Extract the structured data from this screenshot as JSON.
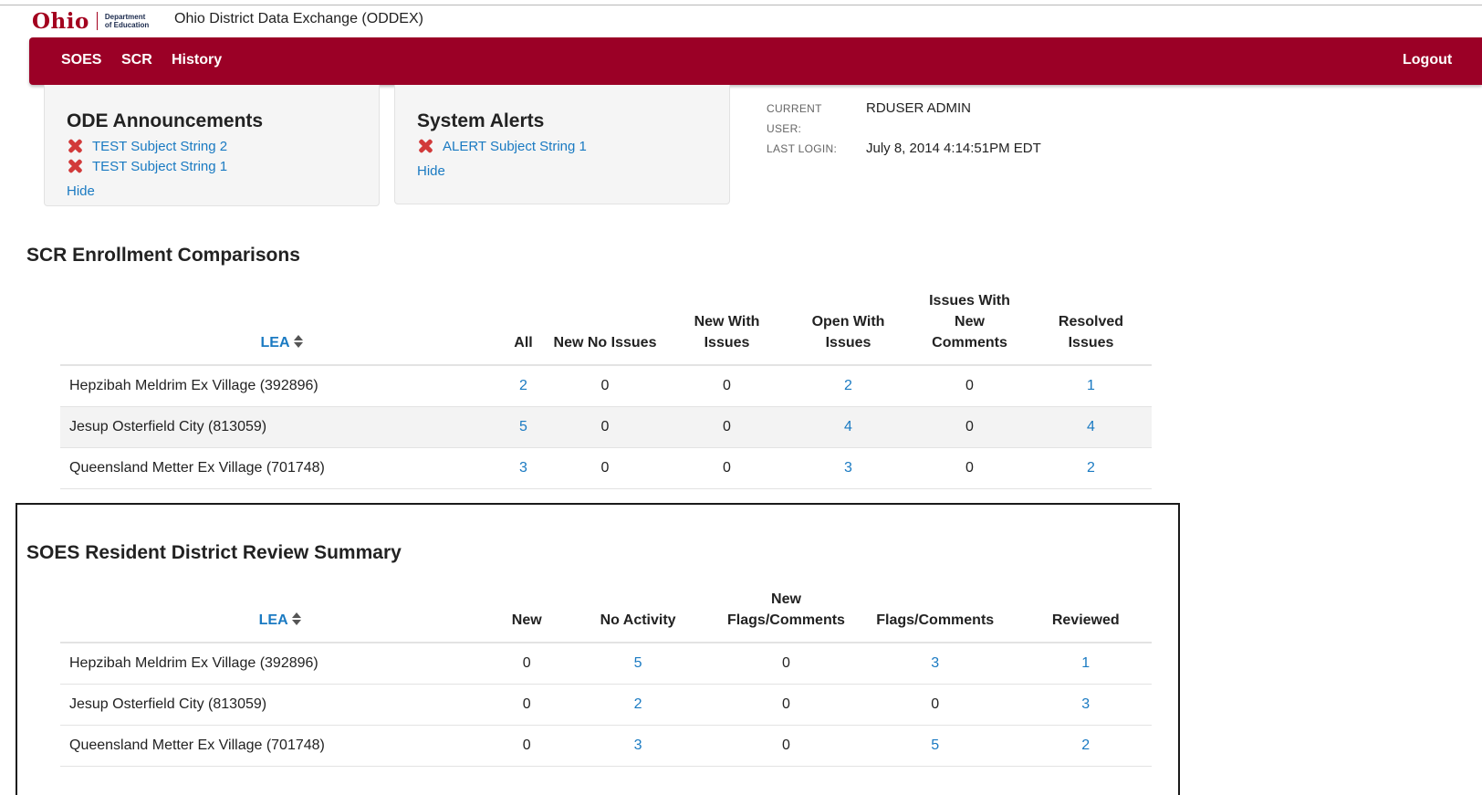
{
  "header": {
    "brand_word": "Ohio",
    "brand_dept_line1": "Department",
    "brand_dept_line2": "of Education",
    "app_title": "Ohio District Data Exchange (ODDEX)"
  },
  "nav": {
    "items": [
      "SOES",
      "SCR",
      "History"
    ],
    "logout": "Logout",
    "color": "#9b0026"
  },
  "announcements": {
    "title": "ODE Announcements",
    "items": [
      "TEST Subject String 2",
      "TEST Subject String 1"
    ],
    "hide": "Hide"
  },
  "alerts": {
    "title": "System Alerts",
    "items": [
      "ALERT Subject String 1"
    ],
    "hide": "Hide"
  },
  "user": {
    "current_user_label_1": "CURRENT",
    "current_user_label_2": "USER:",
    "current_user_value": "RDUSER ADMIN",
    "last_login_label": "LAST LOGIN:",
    "last_login_value": "July 8, 2014 4:14:51PM EDT"
  },
  "scr": {
    "title": "SCR Enrollment Comparisons",
    "headers": {
      "lea": "LEA",
      "all": "All",
      "new_no_issues": "New No Issues",
      "new_with_issues_1": "New With",
      "new_with_issues_2": "Issues",
      "open_with_issues_1": "Open With",
      "open_with_issues_2": "Issues",
      "issues_new_comments_1": "Issues With",
      "issues_new_comments_2": "New",
      "issues_new_comments_3": "Comments",
      "resolved_1": "Resolved",
      "resolved_2": "Issues"
    },
    "rows": [
      {
        "lea": "Hepzibah Meldrim Ex Village (392896)",
        "all": "2",
        "new_no_issues": "0",
        "new_with_issues": "0",
        "open_with_issues": "2",
        "issues_new_comments": "0",
        "resolved": "1"
      },
      {
        "lea": "Jesup Osterfield City (813059)",
        "all": "5",
        "new_no_issues": "0",
        "new_with_issues": "0",
        "open_with_issues": "4",
        "issues_new_comments": "0",
        "resolved": "4"
      },
      {
        "lea": "Queensland Metter Ex Village (701748)",
        "all": "3",
        "new_no_issues": "0",
        "new_with_issues": "0",
        "open_with_issues": "3",
        "issues_new_comments": "0",
        "resolved": "2"
      }
    ]
  },
  "soes": {
    "title": "SOES Resident District Review Summary",
    "headers": {
      "lea": "LEA",
      "new": "New",
      "no_activity": "No Activity",
      "new_flags_1": "New",
      "new_flags_2": "Flags/Comments",
      "flags": "Flags/Comments",
      "reviewed": "Reviewed"
    },
    "rows": [
      {
        "lea": "Hepzibah Meldrim Ex Village (392896)",
        "new": "0",
        "no_activity": "5",
        "new_flags": "0",
        "flags": "3",
        "reviewed": "1"
      },
      {
        "lea": "Jesup Osterfield City (813059)",
        "new": "0",
        "no_activity": "2",
        "new_flags": "0",
        "flags": "0",
        "reviewed": "3"
      },
      {
        "lea": "Queensland Metter Ex Village (701748)",
        "new": "0",
        "no_activity": "3",
        "new_flags": "0",
        "flags": "5",
        "reviewed": "2"
      }
    ]
  }
}
